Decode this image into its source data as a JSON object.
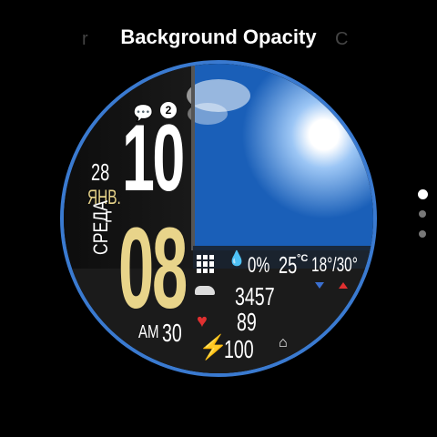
{
  "header": {
    "title": "Background Opacity",
    "ghost_left": "r",
    "ghost_right": "C"
  },
  "watch": {
    "notifications": "2",
    "hour": "10",
    "minute": "08",
    "day": "28",
    "month": "ЯНВ.",
    "weekday": "СРЕДА",
    "ampm": "AM",
    "seconds": "30",
    "precip": "0%",
    "temp": "25",
    "temp_unit": "°C",
    "temp_range": "18°/30°",
    "steps": "3457",
    "heart_rate": "89",
    "battery": "100"
  },
  "colors": {
    "accent": "#3a7ad0",
    "month": "#e8d48a",
    "minutes": "#e8d48a",
    "heart": "#e03030",
    "min_arrow": "#3a6fd0",
    "max_arrow": "#e03030"
  },
  "pagination": {
    "count": 3,
    "active_index": 0
  }
}
